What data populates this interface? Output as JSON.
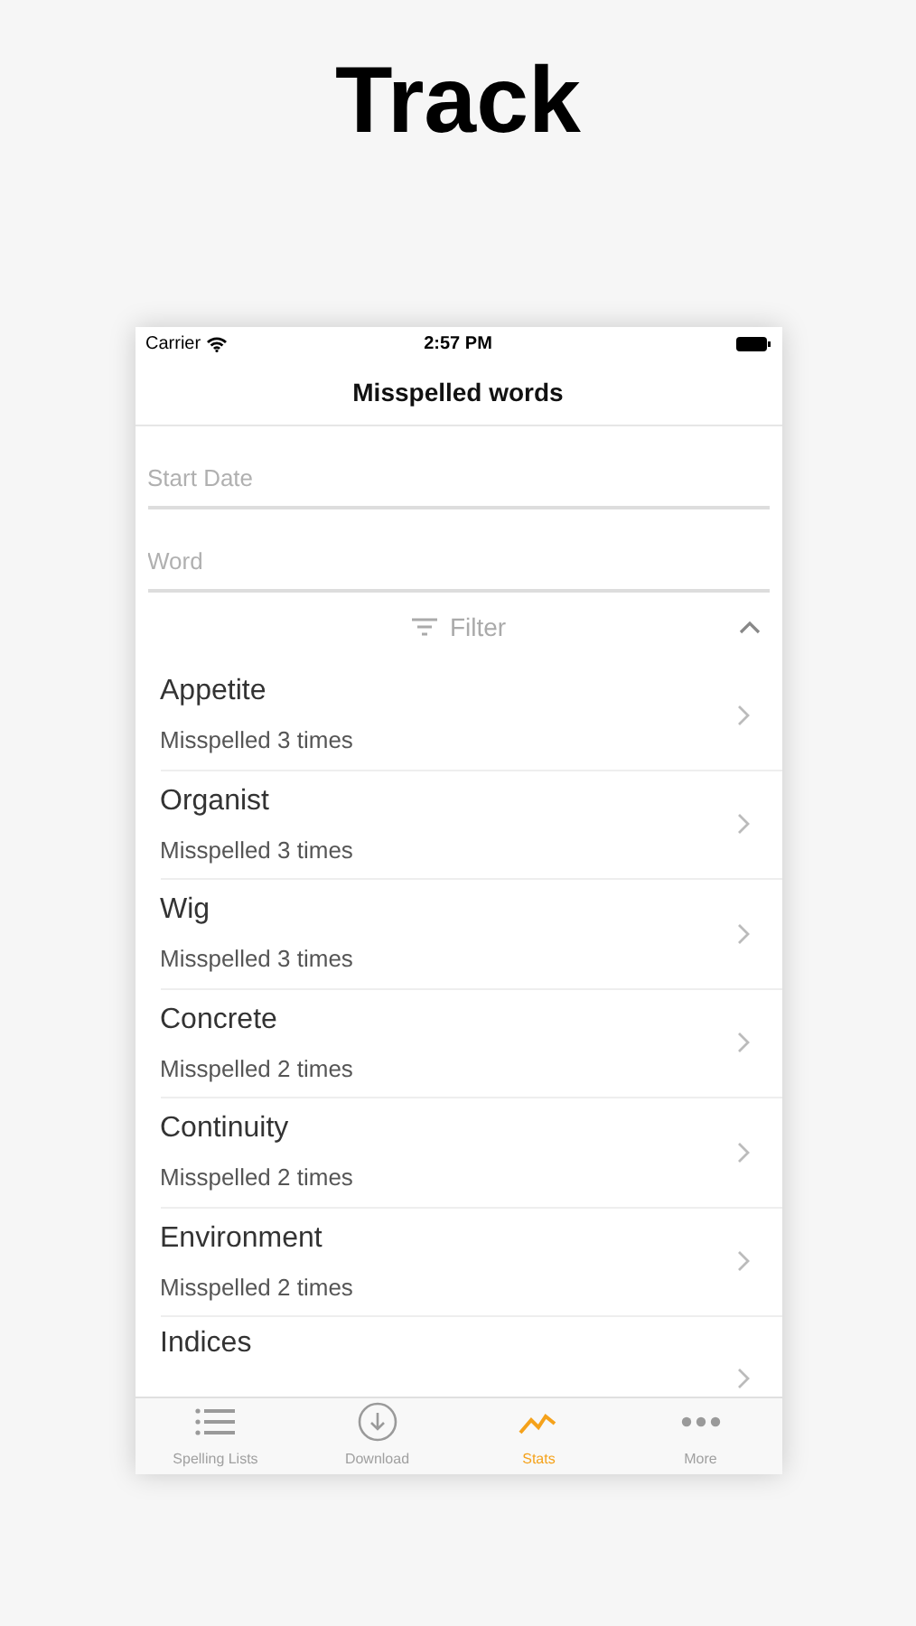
{
  "headline": "Track",
  "status_bar": {
    "carrier": "Carrier",
    "time": "2:57 PM"
  },
  "nav": {
    "title": "Misspelled words"
  },
  "fields": [
    {
      "placeholder": "Start Date"
    },
    {
      "placeholder": "Word"
    }
  ],
  "filter": {
    "label": "Filter",
    "expanded": true
  },
  "rows": [
    {
      "word": "Appetite",
      "detail": "Misspelled 3 times"
    },
    {
      "word": "Organist",
      "detail": "Misspelled 3 times"
    },
    {
      "word": "Wig",
      "detail": "Misspelled 3 times"
    },
    {
      "word": "Concrete",
      "detail": "Misspelled 2 times"
    },
    {
      "word": "Continuity",
      "detail": "Misspelled 2 times"
    },
    {
      "word": "Environment",
      "detail": "Misspelled 2 times"
    },
    {
      "word": "Indices"
    }
  ],
  "tabs": [
    {
      "kind": "list",
      "label": "Spelling Lists",
      "selected": false
    },
    {
      "kind": "download",
      "label": "Download",
      "selected": false
    },
    {
      "kind": "stats",
      "label": "Stats",
      "selected": true
    },
    {
      "kind": "more",
      "label": "More",
      "selected": false
    }
  ]
}
